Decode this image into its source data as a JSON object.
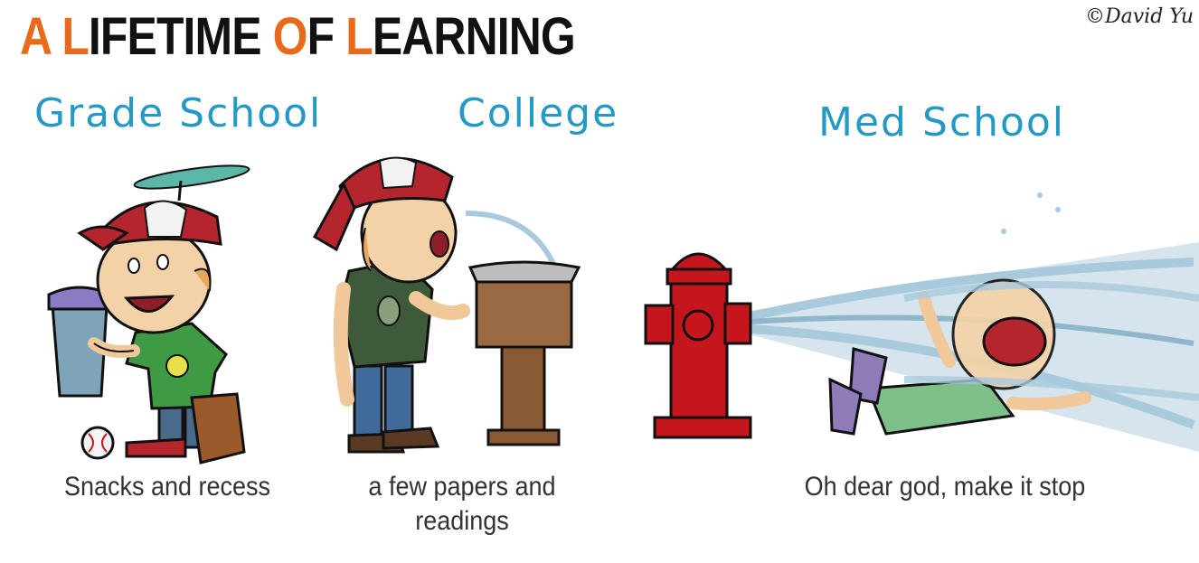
{
  "title": {
    "a1": "A",
    "rest1": " ",
    "l1": "L",
    "rest2": "IFETIME ",
    "o1": "O",
    "rest3": "F ",
    "l2": "L",
    "rest4": "EARNING"
  },
  "credit": "©David Yu",
  "panels": [
    {
      "heading": "Grade School",
      "caption": "Snacks and recess"
    },
    {
      "heading": "College",
      "caption_line1": "a few papers and",
      "caption_line2": "readings"
    },
    {
      "heading": "Med School",
      "caption": "Oh dear god, make it stop"
    }
  ],
  "colors": {
    "accent": "#e86a1a",
    "heading": "#2499c4",
    "cap_red": "#b5252e",
    "shirt_green": "#3f9a44",
    "hydrant_red": "#c4161c",
    "water": "#a9c9dc",
    "fountain_brown": "#8a5a35"
  }
}
